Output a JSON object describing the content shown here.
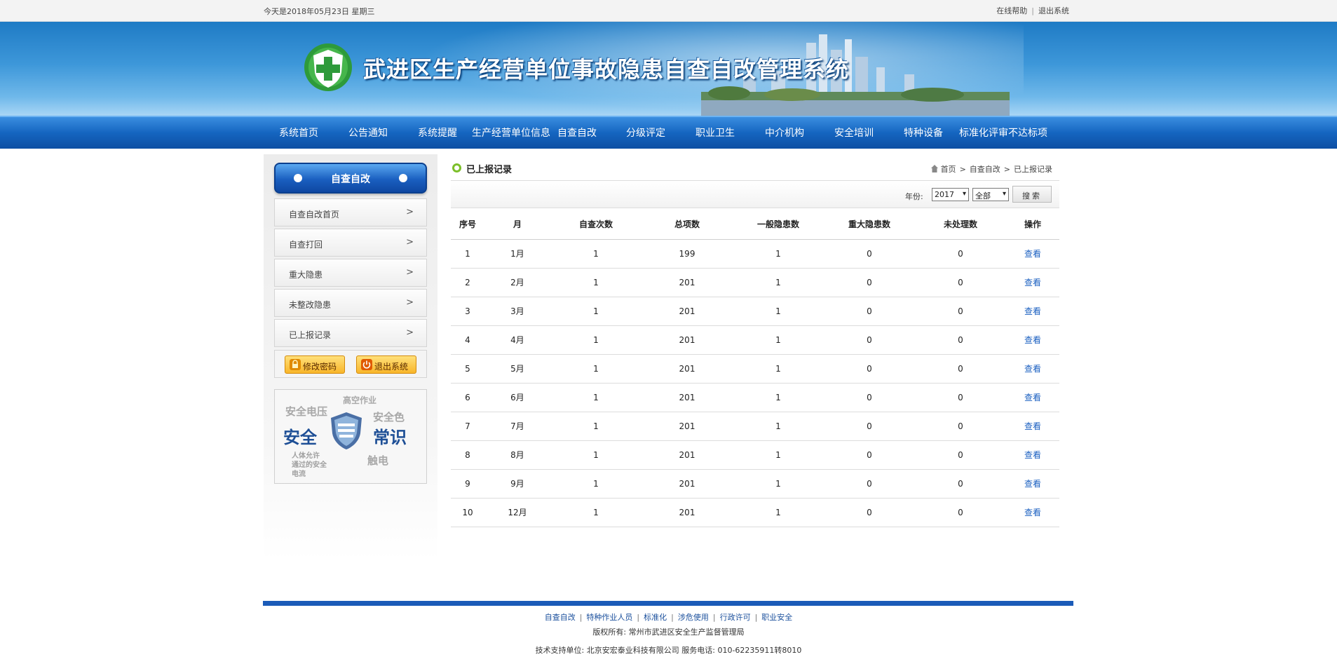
{
  "topbar": {
    "date": "今天是2018年05月23日  星期三",
    "help": "在线帮助",
    "logout": "退出系统"
  },
  "banner": {
    "title": "武进区生产经营单位事故隐患自查自改管理系统",
    "logo_icon": "green-cross-shield-icon"
  },
  "nav": {
    "items": [
      "系统首页",
      "公告通知",
      "系统提醒",
      "生产经营单位信息",
      "自查自改",
      "分级评定",
      "职业卫生",
      "中介机构",
      "安全培训",
      "特种设备",
      "标准化评审不达标项"
    ]
  },
  "sidebar": {
    "title": "自查自改",
    "items": [
      "自查自改首页",
      "自查打回",
      "重大隐患",
      "未整改隐患",
      "已上报记录"
    ],
    "buttons": {
      "change_password": "修改密码",
      "logout": "退出系统"
    },
    "promo": {
      "words": [
        "安全电压",
        "高空作业",
        "安全色",
        "安全",
        "常识",
        "人体允许",
        "通过的安全",
        "电流",
        "触电"
      ]
    }
  },
  "main": {
    "title": "已上报记录",
    "breadcrumb": {
      "home": "首页",
      "level2": "自查自改",
      "current": "已上报记录"
    },
    "filter": {
      "year_label": "年份:",
      "year_value": "2017",
      "scope_value": "全部",
      "search_label": "搜索"
    },
    "table": {
      "headers": [
        "序号",
        "月",
        "自查次数",
        "总项数",
        "一般隐患数",
        "重大隐患数",
        "未处理数",
        "操作"
      ],
      "rows": [
        [
          "1",
          "1月",
          "1",
          "199",
          "1",
          "0",
          "0",
          "查看"
        ],
        [
          "2",
          "2月",
          "1",
          "201",
          "1",
          "0",
          "0",
          "查看"
        ],
        [
          "3",
          "3月",
          "1",
          "201",
          "1",
          "0",
          "0",
          "查看"
        ],
        [
          "4",
          "4月",
          "1",
          "201",
          "1",
          "0",
          "0",
          "查看"
        ],
        [
          "5",
          "5月",
          "1",
          "201",
          "1",
          "0",
          "0",
          "查看"
        ],
        [
          "6",
          "6月",
          "1",
          "201",
          "1",
          "0",
          "0",
          "查看"
        ],
        [
          "7",
          "7月",
          "1",
          "201",
          "1",
          "0",
          "0",
          "查看"
        ],
        [
          "8",
          "8月",
          "1",
          "201",
          "1",
          "0",
          "0",
          "查看"
        ],
        [
          "9",
          "9月",
          "1",
          "201",
          "1",
          "0",
          "0",
          "查看"
        ],
        [
          "10",
          "12月",
          "1",
          "201",
          "1",
          "0",
          "0",
          "查看"
        ]
      ]
    }
  },
  "footer": {
    "links": [
      "自查自改",
      "特种作业人员",
      "标准化",
      "涉危使用",
      "行政许可",
      "职业安全"
    ],
    "copyright": "版权所有: 常州市武进区安全生产监督管理局",
    "support": "技术支持单位:  北京安宏泰业科技有限公司  服务电话: 010-62235911转8010"
  },
  "colors": {
    "nav_blue": "#1565c0",
    "link_blue": "#1a5fc0",
    "button_orange": "#f8b62a",
    "accent_green": "#7cbf2a"
  }
}
